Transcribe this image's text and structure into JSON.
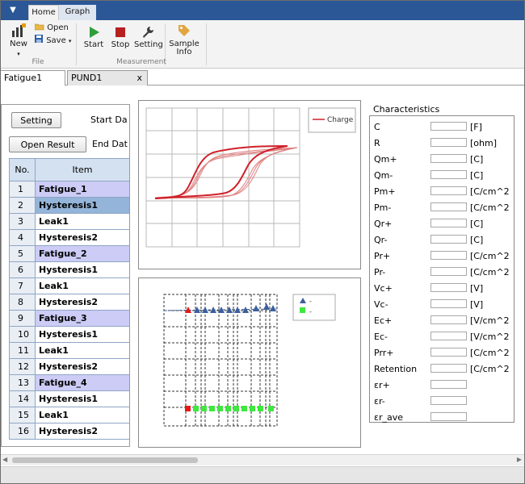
{
  "ribbon": {
    "menu_glyph": "▼",
    "tabs": [
      {
        "label": "Home"
      },
      {
        "label": "Graph"
      }
    ],
    "file_group": {
      "label": "File",
      "new_label": "New",
      "open_label": "Open",
      "save_label": "Save"
    },
    "measurement_group": {
      "label": "Measurement",
      "start_label": "Start",
      "stop_label": "Stop",
      "setting_label": "Setting",
      "sample_info_label1": "Sample",
      "sample_info_label2": "Info"
    }
  },
  "doc_tabs": [
    {
      "label": "Fatigue1"
    },
    {
      "label": "PUND1"
    }
  ],
  "doc_close": "x",
  "left": {
    "setting_button": "Setting",
    "open_result_button": "Open Result",
    "start_date_label": "Start Da",
    "end_date_label": "End Dat",
    "table": {
      "headers": [
        "No.",
        "Item"
      ],
      "rows": [
        {
          "no": "1",
          "item": "Fatigue_1"
        },
        {
          "no": "2",
          "item": "Hysteresis1"
        },
        {
          "no": "3",
          "item": "Leak1"
        },
        {
          "no": "4",
          "item": "Hysteresis2"
        },
        {
          "no": "5",
          "item": "Fatigue_2"
        },
        {
          "no": "6",
          "item": "Hysteresis1"
        },
        {
          "no": "7",
          "item": "Leak1"
        },
        {
          "no": "8",
          "item": "Hysteresis2"
        },
        {
          "no": "9",
          "item": "Fatigue_3"
        },
        {
          "no": "10",
          "item": "Hysteresis1"
        },
        {
          "no": "11",
          "item": "Leak1"
        },
        {
          "no": "12",
          "item": "Hysteresis2"
        },
        {
          "no": "13",
          "item": "Fatigue_4"
        },
        {
          "no": "14",
          "item": "Hysteresis1"
        },
        {
          "no": "15",
          "item": "Leak1"
        },
        {
          "no": "16",
          "item": "Hysteresis2"
        }
      ]
    }
  },
  "hysteresis_chart": {
    "legend": "Charge",
    "series_color": "#d0202a"
  },
  "fatigue_chart": {
    "legend_series1": "-",
    "legend_series2": "-",
    "series1_color": "#3b5f9c",
    "series2_color": "#3ee83e",
    "first_point_color": "#e81818"
  },
  "characteristics": {
    "title": "Characteristics",
    "rows": [
      {
        "label": "C",
        "unit": "[F]"
      },
      {
        "label": "R",
        "unit": "[ohm]"
      },
      {
        "label": "Qm+",
        "unit": "[C]"
      },
      {
        "label": "Qm-",
        "unit": "[C]"
      },
      {
        "label": "Pm+",
        "unit": "[C/cm^2"
      },
      {
        "label": "Pm-",
        "unit": "[C/cm^2"
      },
      {
        "label": "Qr+",
        "unit": "[C]"
      },
      {
        "label": "Qr-",
        "unit": "[C]"
      },
      {
        "label": "Pr+",
        "unit": "[C/cm^2"
      },
      {
        "label": "Pr-",
        "unit": "[C/cm^2"
      },
      {
        "label": "Vc+",
        "unit": "[V]"
      },
      {
        "label": "Vc-",
        "unit": "[V]"
      },
      {
        "label": "Ec+",
        "unit": "[V/cm^2"
      },
      {
        "label": "Ec-",
        "unit": "[V/cm^2"
      },
      {
        "label": "Prr+",
        "unit": "[C/cm^2"
      },
      {
        "label": "Retention",
        "unit": "[C/cm^2"
      },
      {
        "label": "εr+",
        "unit": ""
      },
      {
        "label": "εr-",
        "unit": ""
      },
      {
        "label": "εr_ave",
        "unit": ""
      }
    ]
  }
}
